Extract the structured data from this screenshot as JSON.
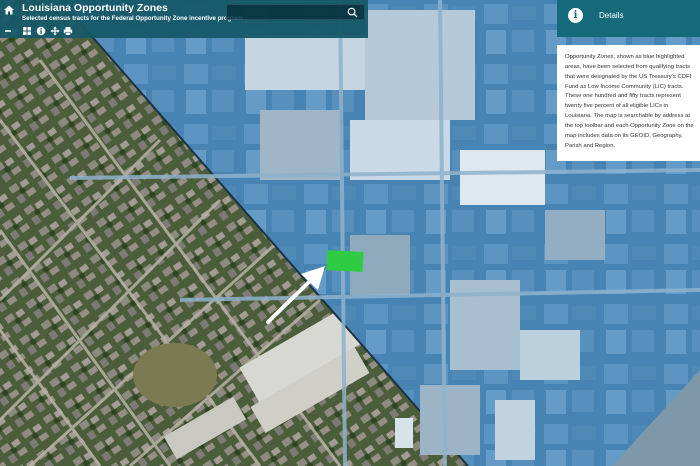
{
  "header": {
    "title": "Louisiana Opportunity Zones",
    "subtitle": "Selected census tracts for the Federal Opportunity Zone incentive program",
    "search_placeholder": ""
  },
  "toolbar": {
    "collapse_label": "–",
    "tools": [
      "grid-icon",
      "info-icon",
      "move-icon",
      "print-icon"
    ]
  },
  "details": {
    "title": "Details",
    "body": "Opportunity Zones, shown as blue highlighted areas, have been selected from qualifying tracts that were designated by the US Treasury's CDFI Fund as Low Income Community (LIC) tracts. These one hundred and fifty tracts represent twenty five percent of all eligible LICs in Louisiana. The map is searchable by address at the top toolbar and each Opportunity Zone on the map includes data on its GEOID, Geography, Parish and Region."
  },
  "colors": {
    "header_bg": "#165868",
    "details_header_bg": "#156a7a",
    "zone_overlay": "#3d8fd2",
    "highlighted_parcel": "#2ecc40",
    "arrow": "#ffffff"
  }
}
